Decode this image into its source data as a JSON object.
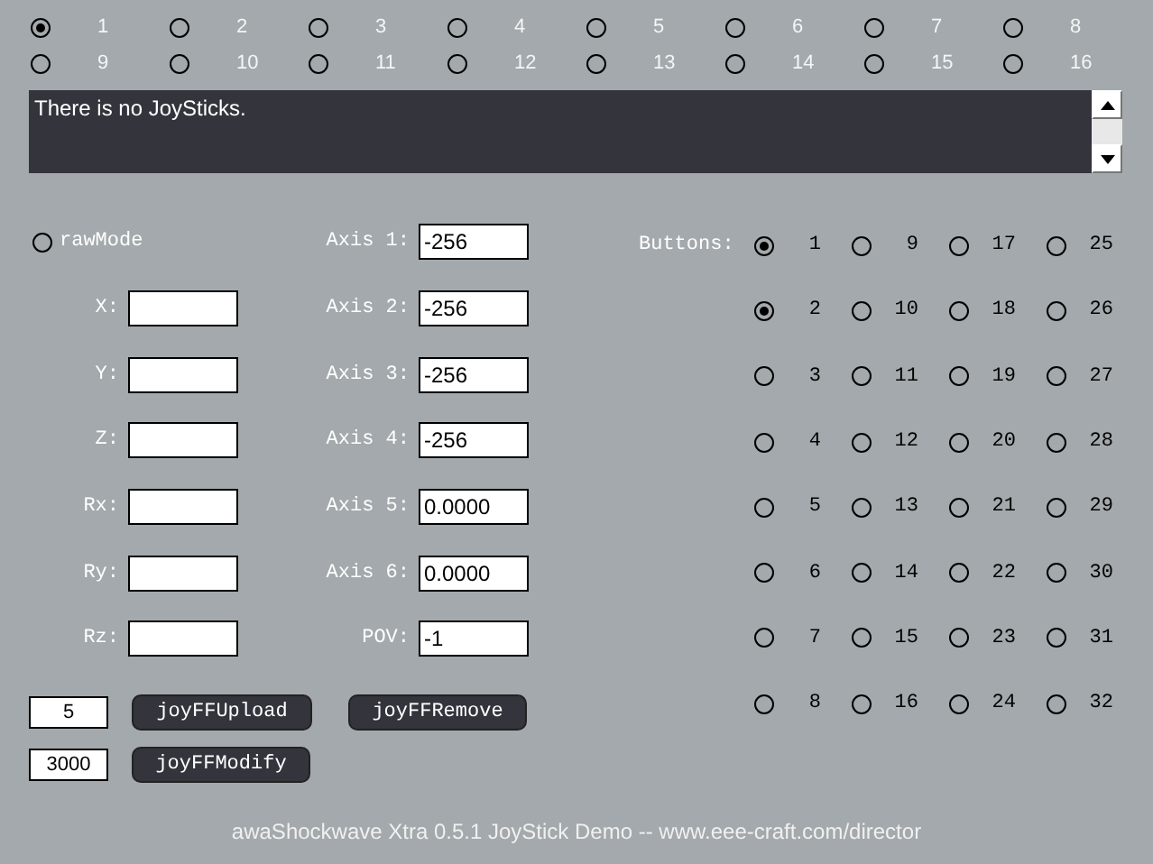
{
  "joysticks": [
    {
      "label": "1",
      "selected": true
    },
    {
      "label": "2",
      "selected": false
    },
    {
      "label": "3",
      "selected": false
    },
    {
      "label": "4",
      "selected": false
    },
    {
      "label": "5",
      "selected": false
    },
    {
      "label": "6",
      "selected": false
    },
    {
      "label": "7",
      "selected": false
    },
    {
      "label": "8",
      "selected": false
    },
    {
      "label": "9",
      "selected": false
    },
    {
      "label": "10",
      "selected": false
    },
    {
      "label": "11",
      "selected": false
    },
    {
      "label": "12",
      "selected": false
    },
    {
      "label": "13",
      "selected": false
    },
    {
      "label": "14",
      "selected": false
    },
    {
      "label": "15",
      "selected": false
    },
    {
      "label": "16",
      "selected": false
    }
  ],
  "message": "There is no JoySticks.",
  "raw_mode": {
    "label": "rawMode",
    "checked": false
  },
  "position_fields": [
    {
      "label": "X:"
    },
    {
      "label": "Y:"
    },
    {
      "label": "Z:"
    },
    {
      "label": "Rx:"
    },
    {
      "label": "Ry:"
    },
    {
      "label": "Rz:"
    }
  ],
  "axis_fields": [
    {
      "label": "Axis 1:",
      "value": "-256"
    },
    {
      "label": "Axis 2:",
      "value": "-256"
    },
    {
      "label": "Axis 3:",
      "value": "-256"
    },
    {
      "label": "Axis 4:",
      "value": "-256"
    },
    {
      "label": "Axis 5:",
      "value": "0.0000"
    },
    {
      "label": "Axis 6:",
      "value": "0.0000"
    },
    {
      "label": "POV:",
      "value": "-1"
    }
  ],
  "buttons_label": "Buttons:",
  "buttons": [
    {
      "label": "1",
      "on": true
    },
    {
      "label": "2",
      "on": true
    },
    {
      "label": "3",
      "on": false
    },
    {
      "label": "4",
      "on": false
    },
    {
      "label": "5",
      "on": false
    },
    {
      "label": "6",
      "on": false
    },
    {
      "label": "7",
      "on": false
    },
    {
      "label": "8",
      "on": false
    },
    {
      "label": "9",
      "on": false
    },
    {
      "label": "10",
      "on": false
    },
    {
      "label": "11",
      "on": false
    },
    {
      "label": "12",
      "on": false
    },
    {
      "label": "13",
      "on": false
    },
    {
      "label": "14",
      "on": false
    },
    {
      "label": "15",
      "on": false
    },
    {
      "label": "16",
      "on": false
    },
    {
      "label": "17",
      "on": false
    },
    {
      "label": "18",
      "on": false
    },
    {
      "label": "19",
      "on": false
    },
    {
      "label": "20",
      "on": false
    },
    {
      "label": "21",
      "on": false
    },
    {
      "label": "22",
      "on": false
    },
    {
      "label": "23",
      "on": false
    },
    {
      "label": "24",
      "on": false
    },
    {
      "label": "25",
      "on": false
    },
    {
      "label": "26",
      "on": false
    },
    {
      "label": "27",
      "on": false
    },
    {
      "label": "28",
      "on": false
    },
    {
      "label": "29",
      "on": false
    },
    {
      "label": "30",
      "on": false
    },
    {
      "label": "31",
      "on": false
    },
    {
      "label": "32",
      "on": false
    }
  ],
  "ff_controls": [
    {
      "value": "5",
      "actions": [
        "joyFFUpload",
        "joyFFRemove"
      ]
    },
    {
      "value": "3000",
      "actions": [
        "joyFFModify"
      ]
    }
  ],
  "footer": "awaShockwave Xtra 0.5.1 JoyStick Demo -- www.eee-craft.com/director"
}
